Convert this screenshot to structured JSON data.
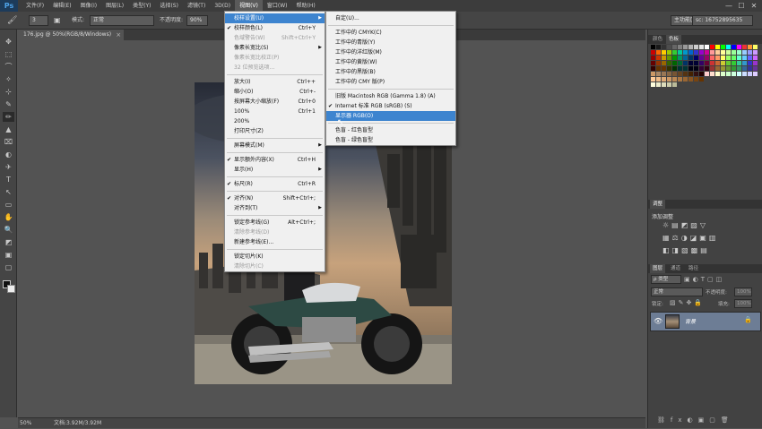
{
  "app": {
    "logo": "Ps"
  },
  "menubar": {
    "items": [
      "文件(F)",
      "编辑(E)",
      "图像(I)",
      "图层(L)",
      "类型(Y)",
      "选择(S)",
      "滤镜(T)",
      "3D(D)",
      "视图(V)",
      "窗口(W)",
      "帮助(H)"
    ],
    "active_index": 8,
    "controls": {
      "minimize": "—",
      "maximize": "☐",
      "close": "✕"
    }
  },
  "optbar": {
    "mode_label": "模式:",
    "mode_value": "正常",
    "opacity_label": "不透明度:",
    "opacity_value": "90%",
    "brush_size": "3",
    "workspace_value": "主功能区",
    "user_value": "sc: 16752895635"
  },
  "doc": {
    "tab_title": "176.jpg @ 50%(RGB/8/Windows)",
    "close": "×"
  },
  "statusbar": {
    "zoom": "50%",
    "doc_info": "文档:3.92M/3.92M"
  },
  "view_menu": {
    "items": [
      {
        "label": "校样设置(U)",
        "arrow": true,
        "highlight": true
      },
      {
        "label": "校样颜色(L)",
        "shortcut": "Ctrl+Y",
        "check": true
      },
      {
        "label": "色域警告(W)",
        "shortcut": "Shift+Ctrl+Y",
        "disabled": true
      },
      {
        "label": "像素长宽比(S)",
        "arrow": true
      },
      {
        "label": "像素长宽比校正(P)",
        "disabled": true
      },
      {
        "label": "32 位预览选项...",
        "disabled": true
      },
      {
        "sep": true
      },
      {
        "label": "放大(I)",
        "shortcut": "Ctrl++"
      },
      {
        "label": "缩小(O)",
        "shortcut": "Ctrl+-"
      },
      {
        "label": "按屏幕大小缩放(F)",
        "shortcut": "Ctrl+0"
      },
      {
        "label": "100%",
        "shortcut": "Ctrl+1"
      },
      {
        "label": "200%"
      },
      {
        "label": "打印尺寸(Z)"
      },
      {
        "sep": true
      },
      {
        "label": "屏幕模式(M)",
        "arrow": true
      },
      {
        "sep": true
      },
      {
        "label": "显示额外内容(X)",
        "shortcut": "Ctrl+H",
        "check": true
      },
      {
        "label": "显示(H)",
        "arrow": true
      },
      {
        "sep": true
      },
      {
        "label": "标尺(R)",
        "shortcut": "Ctrl+R",
        "check": true
      },
      {
        "sep": true
      },
      {
        "label": "对齐(N)",
        "shortcut": "Shift+Ctrl+;",
        "check": true
      },
      {
        "label": "对齐到(T)",
        "arrow": true
      },
      {
        "sep": true
      },
      {
        "label": "锁定参考线(G)",
        "shortcut": "Alt+Ctrl+;"
      },
      {
        "label": "清除参考线(D)",
        "disabled": true
      },
      {
        "label": "新建参考线(E)..."
      },
      {
        "sep": true
      },
      {
        "label": "锁定切片(K)"
      },
      {
        "label": "清除切片(C)",
        "disabled": true
      }
    ]
  },
  "proof_menu": {
    "items": [
      {
        "label": "自定(U)..."
      },
      {
        "sep": true
      },
      {
        "label": "工作中的 CMYK(C)"
      },
      {
        "label": "工作中的青版(Y)"
      },
      {
        "label": "工作中的洋红版(M)"
      },
      {
        "label": "工作中的黄版(W)"
      },
      {
        "label": "工作中的黑版(B)"
      },
      {
        "label": "工作中的 CMY 版(P)"
      },
      {
        "sep": true
      },
      {
        "label": "旧版 Macintosh RGB (Gamma 1.8) (A)"
      },
      {
        "label": "Internet 标准 RGB (sRGB) (S)",
        "check": true
      },
      {
        "label": "显示器 RGB(O)",
        "highlight": true
      },
      {
        "sep": true
      },
      {
        "label": "色盲 - 红色盲型"
      },
      {
        "label": "色盲 - 绿色盲型"
      }
    ]
  },
  "panels": {
    "swatch_tabs": [
      "颜色",
      "色板"
    ],
    "adjust_tab": "调整",
    "adjust_title": "添加调整",
    "layer_tabs": [
      "图层",
      "通道",
      "路径"
    ],
    "kind_label": "ρ 类型",
    "blend_value": "正常",
    "opacity_label": "不透明度:",
    "opacity_value": "100%",
    "lock_label": "锁定:",
    "fill_label": "填充:",
    "fill_value": "100%",
    "layer_name": "背景"
  },
  "colors": {
    "highlight": "#3d84cf",
    "panel": "#424242",
    "canvas": "#535353"
  }
}
